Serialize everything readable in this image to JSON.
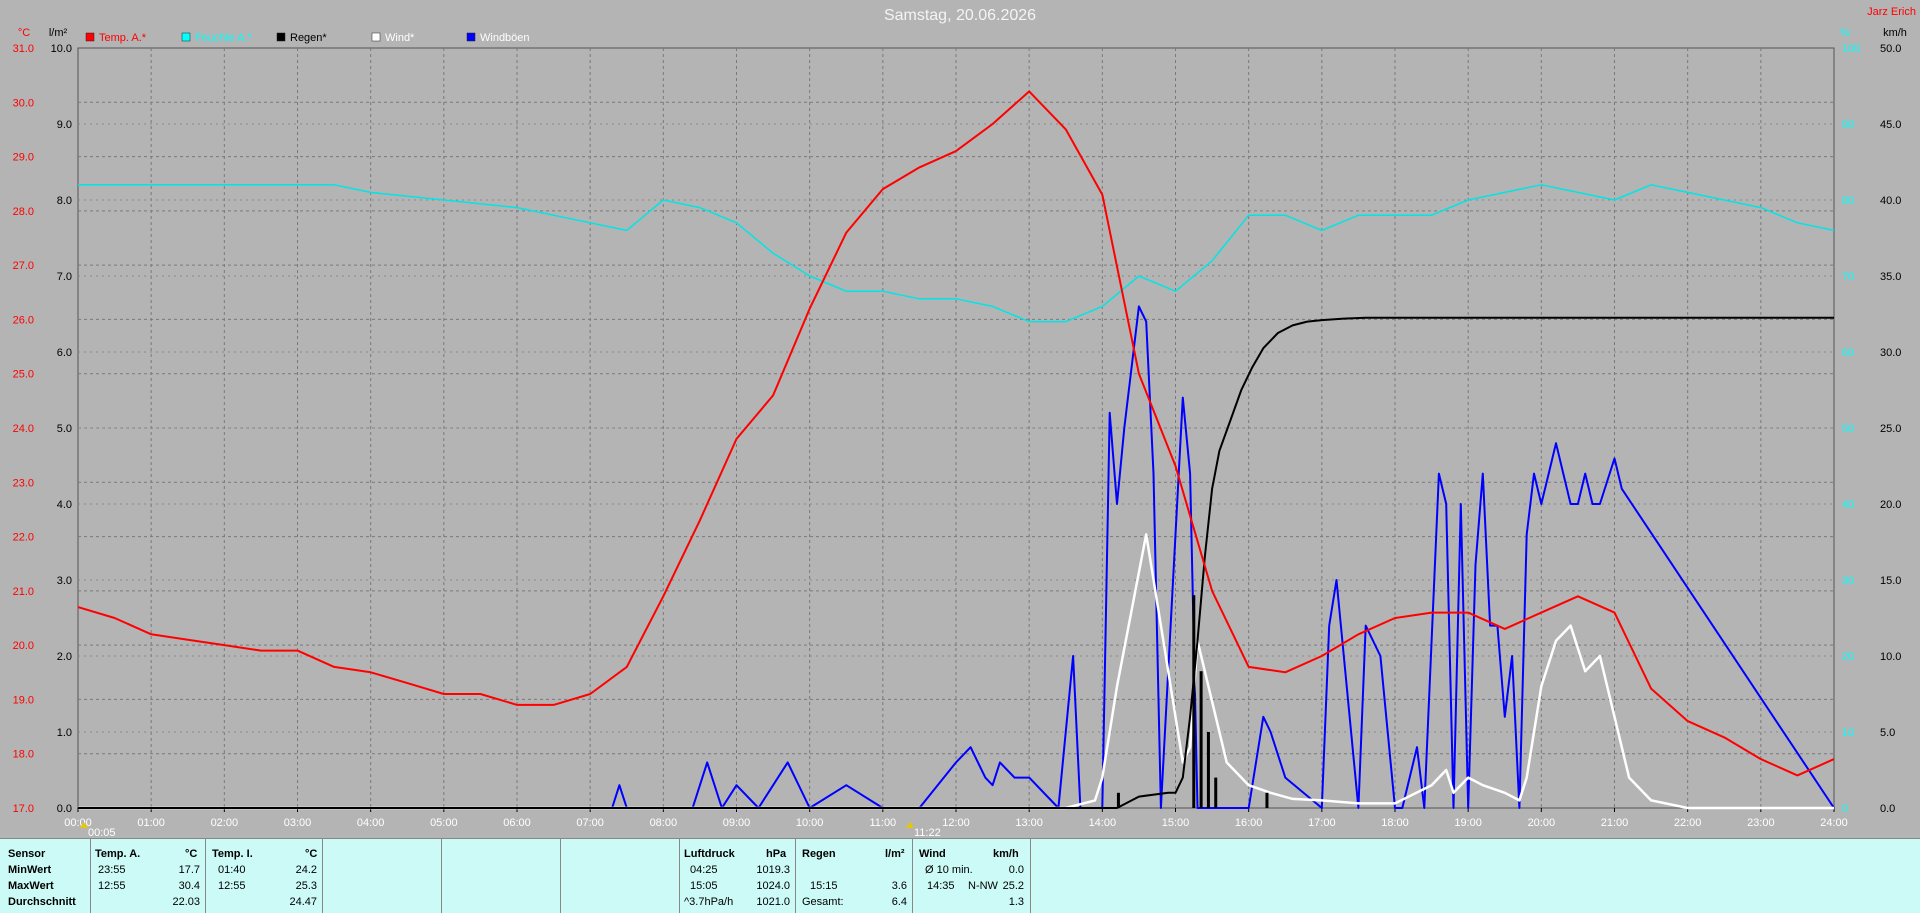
{
  "title": "Samstag, 20.06.2026",
  "corner_label": "Jarz Erich",
  "unit_labels": {
    "temp": "°C",
    "rain": "l/m²",
    "hum": "%",
    "wind": "km/h"
  },
  "legend": [
    {
      "label": "Temp. A.*",
      "color": "#ff0000",
      "text_color": "#ff0000"
    },
    {
      "label": "Feuchte A.*",
      "color": "#00ffff",
      "text_color": "#00ffff"
    },
    {
      "label": "Regen*",
      "color": "#000000",
      "text_color": "#000000"
    },
    {
      "label": "Wind*",
      "color": "#ffffff",
      "text_color": "#ffffff"
    },
    {
      "label": "Windböen",
      "color": "#0000ff",
      "text_color": "#ffffff"
    }
  ],
  "markers": {
    "start": "00:05",
    "mid": "11:22"
  },
  "colors": {
    "temp": "#ff0000",
    "hum": "#00e5e5",
    "rain": "#000000",
    "wind": "#ffffff",
    "gust": "#0000ff"
  },
  "chart_data": {
    "type": "line",
    "title": "Samstag, 20.06.2026",
    "x_unit": "h",
    "xlim": [
      0,
      24
    ],
    "x_ticks": [
      "00:00",
      "01:00",
      "02:00",
      "03:00",
      "04:00",
      "05:00",
      "06:00",
      "07:00",
      "08:00",
      "09:00",
      "10:00",
      "11:00",
      "12:00",
      "13:00",
      "14:00",
      "15:00",
      "16:00",
      "17:00",
      "18:00",
      "19:00",
      "20:00",
      "21:00",
      "22:00",
      "23:00",
      "24:00"
    ],
    "y_left_temp": {
      "label": "°C",
      "range": [
        17,
        31
      ],
      "ticks": [
        "17.0",
        "18.0",
        "19.0",
        "20.0",
        "21.0",
        "22.0",
        "23.0",
        "24.0",
        "25.0",
        "26.0",
        "27.0",
        "28.0",
        "29.0",
        "30.0",
        "31.0"
      ]
    },
    "y_left_rain": {
      "label": "l/m²",
      "range": [
        0,
        10
      ],
      "ticks": [
        "0.0",
        "1.0",
        "2.0",
        "3.0",
        "4.0",
        "5.0",
        "6.0",
        "7.0",
        "8.0",
        "9.0",
        "10.0"
      ]
    },
    "y_right_hum": {
      "label": "%",
      "range": [
        0,
        100
      ],
      "ticks": [
        "0",
        "10",
        "20",
        "30",
        "40",
        "50",
        "60",
        "70",
        "80",
        "90",
        "100"
      ]
    },
    "y_right_wind": {
      "label": "km/h",
      "range": [
        0,
        50
      ],
      "ticks": [
        "0.0",
        "5.0",
        "10.0",
        "15.0",
        "20.0",
        "25.0",
        "30.0",
        "35.0",
        "40.0",
        "45.0",
        "50.0"
      ]
    },
    "grid": true,
    "series": [
      {
        "name": "Temp. A.*",
        "axis": "temp",
        "x": [
          0,
          0.5,
          1,
          1.5,
          2,
          2.5,
          3,
          3.5,
          4,
          4.5,
          5,
          5.5,
          6,
          6.5,
          7,
          7.5,
          8,
          8.5,
          9,
          9.5,
          10,
          10.5,
          11,
          11.5,
          12,
          12.5,
          13,
          13.5,
          14,
          14.5,
          15,
          15.5,
          16,
          16.5,
          17,
          17.5,
          18,
          18.5,
          19,
          19.5,
          20,
          20.5,
          21,
          21.5,
          22,
          22.5,
          23,
          23.5,
          24
        ],
        "values": [
          20.7,
          20.5,
          20.2,
          20.1,
          20.0,
          19.9,
          19.9,
          19.6,
          19.5,
          19.3,
          19.1,
          19.1,
          18.9,
          18.9,
          19.1,
          19.6,
          20.9,
          22.3,
          23.8,
          24.6,
          26.2,
          27.6,
          28.4,
          28.8,
          29.1,
          29.6,
          30.2,
          29.5,
          28.3,
          25.0,
          23.3,
          21.0,
          19.6,
          19.5,
          19.8,
          20.2,
          20.5,
          20.6,
          20.6,
          20.3,
          20.6,
          20.9,
          20.6,
          19.2,
          18.6,
          18.3,
          17.9,
          17.6,
          17.9
        ]
      },
      {
        "name": "Feuchte A.*",
        "axis": "hum",
        "x": [
          0,
          1,
          2,
          3,
          3.5,
          4,
          5,
          6,
          7,
          7.5,
          8,
          8.5,
          9,
          9.5,
          10,
          10.5,
          11,
          11.5,
          12,
          12.5,
          13,
          13.5,
          14,
          14.5,
          15,
          15.5,
          16,
          16.5,
          17,
          17.5,
          18,
          18.5,
          19,
          19.5,
          20,
          20.5,
          21,
          21.5,
          22,
          22.5,
          23,
          23.5,
          24
        ],
        "values": [
          82,
          82,
          82,
          82,
          82,
          81,
          80,
          79,
          77,
          76,
          80,
          79,
          77,
          73,
          70,
          68,
          68,
          67,
          67,
          66,
          64,
          64,
          66,
          70,
          68,
          72,
          78,
          78,
          76,
          78,
          78,
          78,
          80,
          81,
          82,
          81,
          80,
          82,
          81,
          80,
          79,
          77,
          76
        ]
      },
      {
        "name": "Regen*",
        "axis": "rain",
        "x": [
          0,
          14.2,
          14.5,
          14.9,
          15.0,
          15.1,
          15.2,
          15.3,
          15.4,
          15.5,
          15.6,
          15.75,
          15.9,
          16.05,
          16.2,
          16.4,
          16.6,
          16.8,
          17.0,
          17.3,
          17.6,
          18,
          19,
          20,
          21,
          22,
          23,
          24
        ],
        "values": [
          0,
          0,
          0.15,
          0.2,
          0.2,
          0.4,
          1.2,
          2.2,
          3.3,
          4.2,
          4.7,
          5.1,
          5.5,
          5.8,
          6.05,
          6.25,
          6.35,
          6.4,
          6.42,
          6.44,
          6.45,
          6.45,
          6.45,
          6.45,
          6.45,
          6.45,
          6.45,
          6.45
        ]
      },
      {
        "name": "Wind*",
        "axis": "wind",
        "x": [
          0,
          13.5,
          13.9,
          14.0,
          14.2,
          14.4,
          14.6,
          14.8,
          15.0,
          15.1,
          15.2,
          15.3,
          15.5,
          15.7,
          16.0,
          16.3,
          16.6,
          17.0,
          17.5,
          18.0,
          18.5,
          18.7,
          18.8,
          19.0,
          19.2,
          19.5,
          19.7,
          19.8,
          20.0,
          20.2,
          20.4,
          20.6,
          20.8,
          21.0,
          21.2,
          21.5,
          22,
          24
        ],
        "values": [
          0,
          0,
          0.5,
          2,
          8,
          13,
          18,
          12,
          6,
          3,
          4,
          11,
          7,
          3,
          1.5,
          1,
          0.6,
          0.5,
          0.3,
          0.3,
          1.5,
          2.5,
          1,
          2,
          1.5,
          1,
          0.5,
          2,
          8,
          11,
          12,
          9,
          10,
          6,
          2,
          0.5,
          0,
          0
        ]
      },
      {
        "name": "Windböen",
        "axis": "wind",
        "x": [
          0,
          7.3,
          7.4,
          7.5,
          8.4,
          8.6,
          8.8,
          9.0,
          9.3,
          9.7,
          10.0,
          10.5,
          11.0,
          11.5,
          12.0,
          12.2,
          12.4,
          12.5,
          12.6,
          12.8,
          13.0,
          13.4,
          13.6,
          13.7,
          14.0,
          14.1,
          14.2,
          14.3,
          14.5,
          14.6,
          14.7,
          14.8,
          15.0,
          15.1,
          15.2,
          15.3,
          15.4,
          15.5,
          15.6,
          16.0,
          16.2,
          16.3,
          16.5,
          17.0,
          17.1,
          17.2,
          17.5,
          17.6,
          17.8,
          18.0,
          18.1,
          18.3,
          18.4,
          18.6,
          18.7,
          18.8,
          18.9,
          19.0,
          19.1,
          19.2,
          19.3,
          19.4,
          19.5,
          19.6,
          19.7,
          19.8,
          19.9,
          20.0,
          20.1,
          20.2,
          20.3,
          20.4,
          20.5,
          20.6,
          20.7,
          20.8,
          21.0,
          21.1,
          24
        ],
        "values": [
          0,
          0,
          1.5,
          0,
          0,
          3,
          0,
          1.5,
          0,
          3,
          0,
          1.5,
          0,
          0,
          3,
          4,
          2,
          1.5,
          3,
          2,
          2,
          0,
          10,
          0,
          0,
          26,
          20,
          25,
          33,
          32,
          22,
          0,
          18,
          27,
          22,
          0,
          0,
          0,
          0,
          0,
          6,
          5,
          2,
          0,
          12,
          15,
          0,
          12,
          10,
          0,
          0,
          4,
          0,
          22,
          20,
          0,
          20,
          0,
          16,
          22,
          12,
          12,
          6,
          10,
          0,
          18,
          22,
          20,
          22,
          24,
          22,
          20,
          20,
          22,
          20,
          20,
          23,
          21,
          0
        ]
      }
    ]
  },
  "stats": {
    "headers": {
      "sensor": "Sensor",
      "temp_a": "Temp. A.",
      "temp_a_unit": "°C",
      "temp_i": "Temp. I.",
      "temp_i_unit": "°C",
      "luftdruck": "Luftdruck",
      "luftdruck_unit": "hPa",
      "regen": "Regen",
      "regen_unit": "l/m²",
      "wind": "Wind",
      "wind_unit": "km/h"
    },
    "row_labels": [
      "MinWert",
      "MaxWert",
      "Durchschnitt"
    ],
    "temp_a": [
      {
        "time": "23:55",
        "value": "17.7"
      },
      {
        "time": "12:55",
        "value": "30.4"
      },
      {
        "time": "",
        "value": "22.03"
      }
    ],
    "temp_i": [
      {
        "time": "01:40",
        "value": "24.2"
      },
      {
        "time": "12:55",
        "value": "25.3"
      },
      {
        "time": "",
        "value": "24.47"
      }
    ],
    "luftdruck": [
      {
        "time": "04:25",
        "value": "1019.3"
      },
      {
        "time": "15:05",
        "value": "1024.0"
      },
      {
        "time": "^3.7hPa/h",
        "value": "1021.0"
      }
    ],
    "regen": [
      {
        "time": "",
        "value": ""
      },
      {
        "time": "15:15",
        "value": "3.6"
      },
      {
        "time": "Gesamt:",
        "value": "6.4"
      }
    ],
    "wind": [
      {
        "time": "Ø 10 min.",
        "dir": "",
        "value": "0.0"
      },
      {
        "time": "14:35",
        "dir": "N-NW",
        "value": "25.2"
      },
      {
        "time": "",
        "dir": "",
        "value": "1.3"
      }
    ]
  }
}
